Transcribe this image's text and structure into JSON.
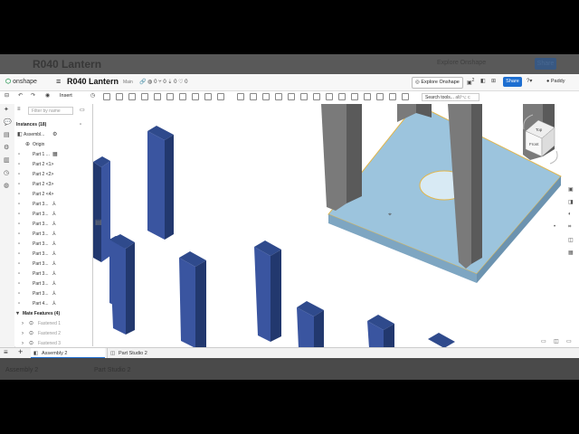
{
  "ghost": {
    "title": "R040 Lantern",
    "explore": "Explore Onshape",
    "share": "Share",
    "tabs": [
      "Assembly 2",
      "Part Studio 2"
    ]
  },
  "header": {
    "logo": "onshape",
    "title": "R040 Lantern",
    "branch": "Main",
    "counts": [
      "0",
      "0",
      "0",
      "0"
    ],
    "explore_label": "Explore Onshape",
    "notification_count": "2",
    "share_label": "Share",
    "user": "Paddy"
  },
  "toolbar": {
    "insert_label": "Insert",
    "search_placeholder": "Search tools...",
    "search_shortcut": "alt/⌥ c"
  },
  "panel": {
    "filter_placeholder": "Filter by name",
    "instances_header": "Instances (18)",
    "assembly_label": "Assembl...",
    "origin_label": "Origin",
    "items": [
      "Part 1 ...",
      "Part 2 <1>",
      "Part 2 <2>",
      "Part 2 <3>",
      "Part 2 <4>",
      "Part 3...",
      "Part 3...",
      "Part 3...",
      "Part 3...",
      "Part 3...",
      "Part 3...",
      "Part 3...",
      "Part 3...",
      "Part 3...",
      "Part 3...",
      "Part 4..."
    ],
    "mate_header": "Mate Features (4)",
    "mates": [
      "Fastened 1",
      "Fastened 2",
      "Fastened 3"
    ]
  },
  "tabs": {
    "items": [
      "Assembly 2",
      "Part Studio 2"
    ]
  },
  "viewcube": {
    "top": "Top",
    "front": "Front"
  },
  "colors": {
    "accent": "#1e6fd1",
    "part_blue": "#2f4a8c",
    "plate": "#9cc4dd",
    "post": "#6e6e6e",
    "selection": "#e2b64a"
  }
}
